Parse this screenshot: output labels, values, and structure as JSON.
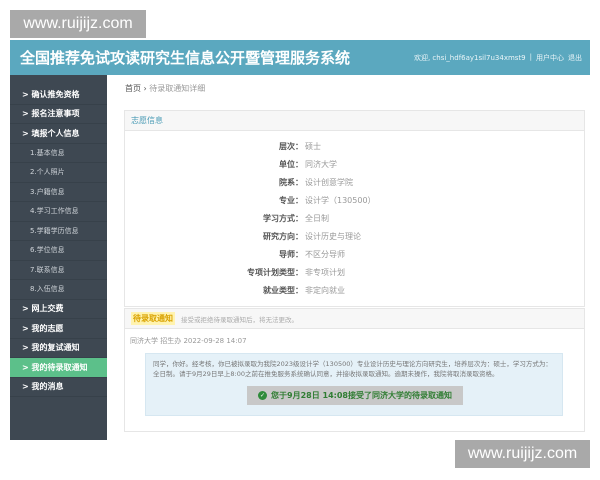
{
  "watermark": "www.ruijijz.com",
  "header": {
    "title": "全国推荐免试攻读研究生信息公开暨管理服务系统",
    "welcome": "欢迎, chsi_hdf6ay1sil7u34xmst9",
    "sep": "|",
    "user_center": "用户中心",
    "logout": "退出"
  },
  "sidebar": {
    "items": [
      {
        "label": "> 确认推免资格",
        "type": "top"
      },
      {
        "label": "> 报名注意事项",
        "type": "top"
      },
      {
        "label": "> 填报个人信息",
        "type": "top"
      },
      {
        "label": "1.基本信息",
        "type": "sub"
      },
      {
        "label": "2.个人照片",
        "type": "sub"
      },
      {
        "label": "3.户籍信息",
        "type": "sub"
      },
      {
        "label": "4.学习工作信息",
        "type": "sub"
      },
      {
        "label": "5.学籍学历信息",
        "type": "sub"
      },
      {
        "label": "6.学位信息",
        "type": "sub"
      },
      {
        "label": "7.联系信息",
        "type": "sub"
      },
      {
        "label": "8.入伍信息",
        "type": "sub"
      },
      {
        "label": "> 网上交费",
        "type": "top"
      },
      {
        "label": "> 我的志愿",
        "type": "top"
      },
      {
        "label": "> 我的复试通知",
        "type": "top"
      },
      {
        "label": "> 我的待录取通知",
        "type": "top",
        "active": true
      },
      {
        "label": "> 我的消息",
        "type": "top"
      }
    ]
  },
  "breadcrumb": {
    "home": "首页",
    "sep": "›",
    "current": "待录取通知详细"
  },
  "volunteer": {
    "title": "志愿信息",
    "rows": [
      {
        "k": "层次：",
        "v": "硕士"
      },
      {
        "k": "单位：",
        "v": "同济大学"
      },
      {
        "k": "院系：",
        "v": "设计创意学院"
      },
      {
        "k": "专业：",
        "v": "设计学（130500）"
      },
      {
        "k": "学习方式：",
        "v": "全日制"
      },
      {
        "k": "研究方向：",
        "v": "设计历史与理论"
      },
      {
        "k": "导师：",
        "v": "不区分导师"
      },
      {
        "k": "专项计划类型：",
        "v": "非专项计划"
      },
      {
        "k": "就业类型：",
        "v": "非定向就业"
      }
    ]
  },
  "notice": {
    "tag": "待录取通知",
    "hint": "接受或拒绝待录取通知后，将无法更改。",
    "source": "同济大学 招生办 2022-09-28 14:07",
    "body": "同学，你好。经考核，你已被拟录取为我院2023级设计学（130500）专业设计历史与理论方向研究生，培养层次为：硕士，学习方式为：全日制。请于9月29日早上8:00之前在推免服务系统确认同意，并接收拟录取通知。逾期未操作，我院将取消录取资格。",
    "accepted": "您于9月28日 14:08接受了同济大学的待录取通知",
    "accent": "#5cc08a"
  }
}
